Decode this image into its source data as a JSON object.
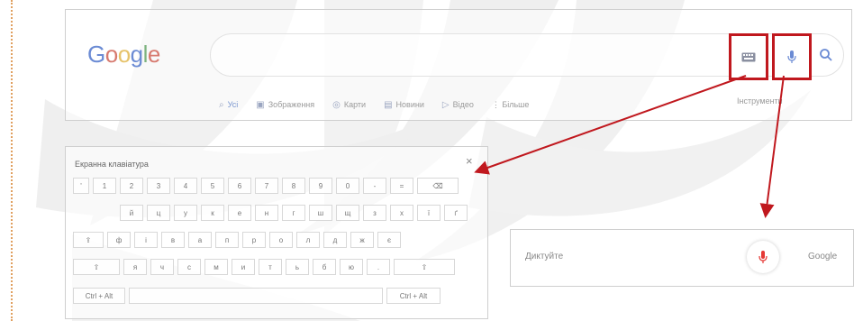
{
  "search": {
    "logo_letters": [
      "G",
      "o",
      "o",
      "g",
      "l",
      "e"
    ],
    "placeholder": ""
  },
  "tabs": [
    {
      "icon": "search-icon",
      "label": "Усі",
      "active": true
    },
    {
      "icon": "image-icon",
      "label": "Зображення"
    },
    {
      "icon": "map-pin-icon",
      "label": "Карти"
    },
    {
      "icon": "news-icon",
      "label": "Новини"
    },
    {
      "icon": "video-icon",
      "label": "Відео"
    },
    {
      "icon": "",
      "label": "⋮ Більше"
    }
  ],
  "tools_label": "Інструменти",
  "keyboard": {
    "title": "Екранна клавіатура",
    "close": "×",
    "rows": [
      [
        "'",
        "1",
        "2",
        "3",
        "4",
        "5",
        "6",
        "7",
        "8",
        "9",
        "0",
        "-",
        "=",
        "⌫"
      ],
      [
        "й",
        "ц",
        "у",
        "к",
        "е",
        "н",
        "г",
        "ш",
        "щ",
        "з",
        "х",
        "ї",
        "ґ"
      ],
      [
        "⇪",
        "ф",
        "і",
        "в",
        "а",
        "п",
        "р",
        "о",
        "л",
        "д",
        "ж",
        "є"
      ],
      [
        "⇧",
        "я",
        "ч",
        "с",
        "м",
        "и",
        "т",
        "ь",
        "б",
        "ю",
        ".",
        "⇧"
      ],
      [
        "Ctrl + Alt",
        "",
        "Ctrl + Alt"
      ]
    ]
  },
  "voice": {
    "prompt": "Диктуйте",
    "brand": "Google"
  },
  "colors": {
    "highlight": "#c0181e",
    "mic_red": "#e53935"
  }
}
